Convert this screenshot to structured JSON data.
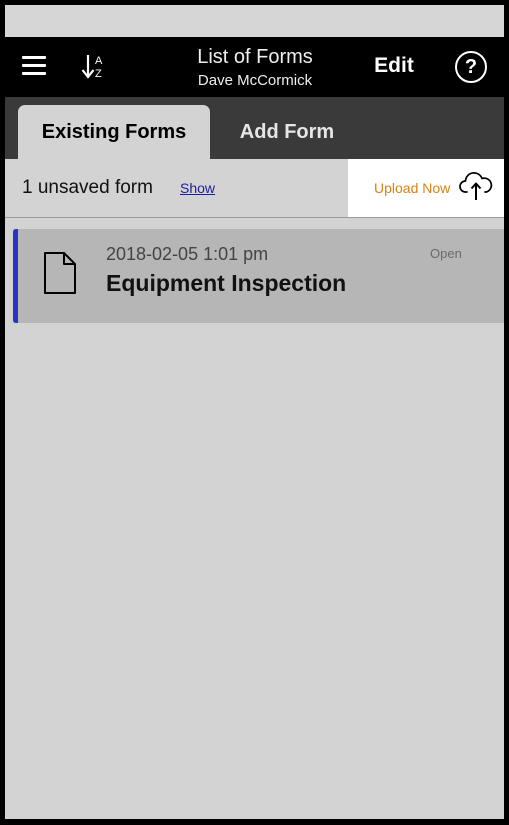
{
  "header": {
    "title": "List of Forms",
    "subtitle": "Dave McCormick",
    "edit_label": "Edit",
    "help_label": "?",
    "sort_icon": "sort-alpha-icon",
    "sort_letter_top": "A",
    "sort_letter_bottom": "Z",
    "menu_icon": "hamburger-menu-icon"
  },
  "tabs": [
    {
      "label": "Existing Forms",
      "active": true
    },
    {
      "label": "Add Form",
      "active": false
    }
  ],
  "notice": {
    "text": "1 unsaved form",
    "show_label": "Show",
    "upload_label": "Upload Now",
    "upload_icon": "cloud-upload-icon"
  },
  "forms": [
    {
      "date": "2018-02-05 1:01 pm",
      "title": "Equipment Inspection",
      "status": "Open",
      "icon": "document-icon"
    }
  ],
  "colors": {
    "navbar": "#000000",
    "tabbar": "#3a3a3a",
    "background": "#d3d3d3",
    "row_background": "#b6b6b6",
    "row_accent": "#2a33c8",
    "upload_text": "#d98214",
    "link": "#1c1ca6"
  }
}
